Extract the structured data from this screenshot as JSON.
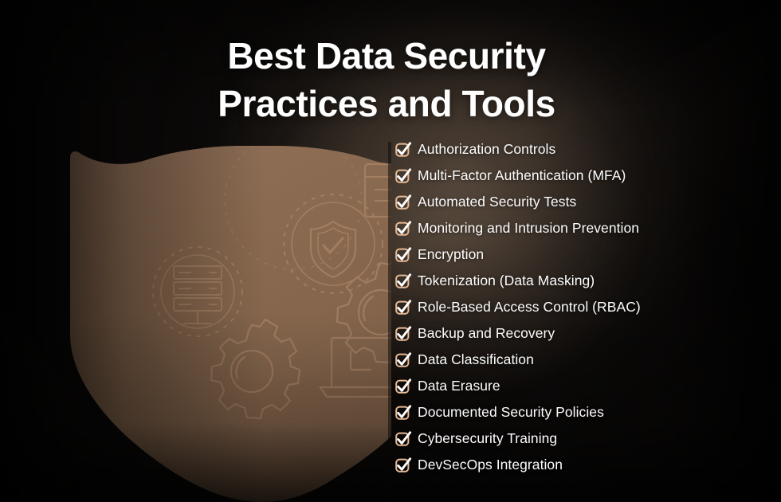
{
  "poster": {
    "title_line1": "Best Data Security",
    "title_line2": "Practices and Tools",
    "title_full": "Best Data Security\nPractices and Tools",
    "colors": {
      "background": "#0c0a09",
      "background_glow": "#3a322c",
      "shield_fill": "#8a6a50",
      "shield_edge": "#6d5340",
      "checkbox_outline": "#e8b994",
      "check_mark": "#ffffff",
      "title_text": "#ffffff",
      "list_text": "#fdfdfd"
    }
  },
  "checklist": {
    "items": [
      {
        "label": "Authorization Controls",
        "icon": "checkbox-checked-icon"
      },
      {
        "label": "Multi-Factor Authentication (MFA)",
        "icon": "checkbox-checked-icon"
      },
      {
        "label": "Automated Security Tests",
        "icon": "checkbox-checked-icon"
      },
      {
        "label": "Monitoring and Intrusion Prevention",
        "icon": "checkbox-checked-icon"
      },
      {
        "label": "Encryption",
        "icon": "checkbox-checked-icon"
      },
      {
        "label": "Tokenization (Data Masking)",
        "icon": "checkbox-checked-icon"
      },
      {
        "label": "Role-Based Access Control (RBAC)",
        "icon": "checkbox-checked-icon"
      },
      {
        "label": "Backup and Recovery",
        "icon": "checkbox-checked-icon"
      },
      {
        "label": "Data Classification",
        "icon": "checkbox-checked-icon"
      },
      {
        "label": "Data Erasure",
        "icon": "checkbox-checked-icon"
      },
      {
        "label": "Documented Security Policies",
        "icon": "checkbox-checked-icon"
      },
      {
        "label": "Cybersecurity Training",
        "icon": "checkbox-checked-icon"
      },
      {
        "label": "DevSecOps Integration",
        "icon": "checkbox-checked-icon"
      }
    ]
  },
  "shield_graphic": {
    "name": "security-shield",
    "decorative_icons": [
      "shield-check-icon",
      "server-stack-icon",
      "gear-icon",
      "gear-icon",
      "laptop-icon",
      "document-icon",
      "dotted-circle-icon",
      "dotted-circle-icon"
    ]
  }
}
